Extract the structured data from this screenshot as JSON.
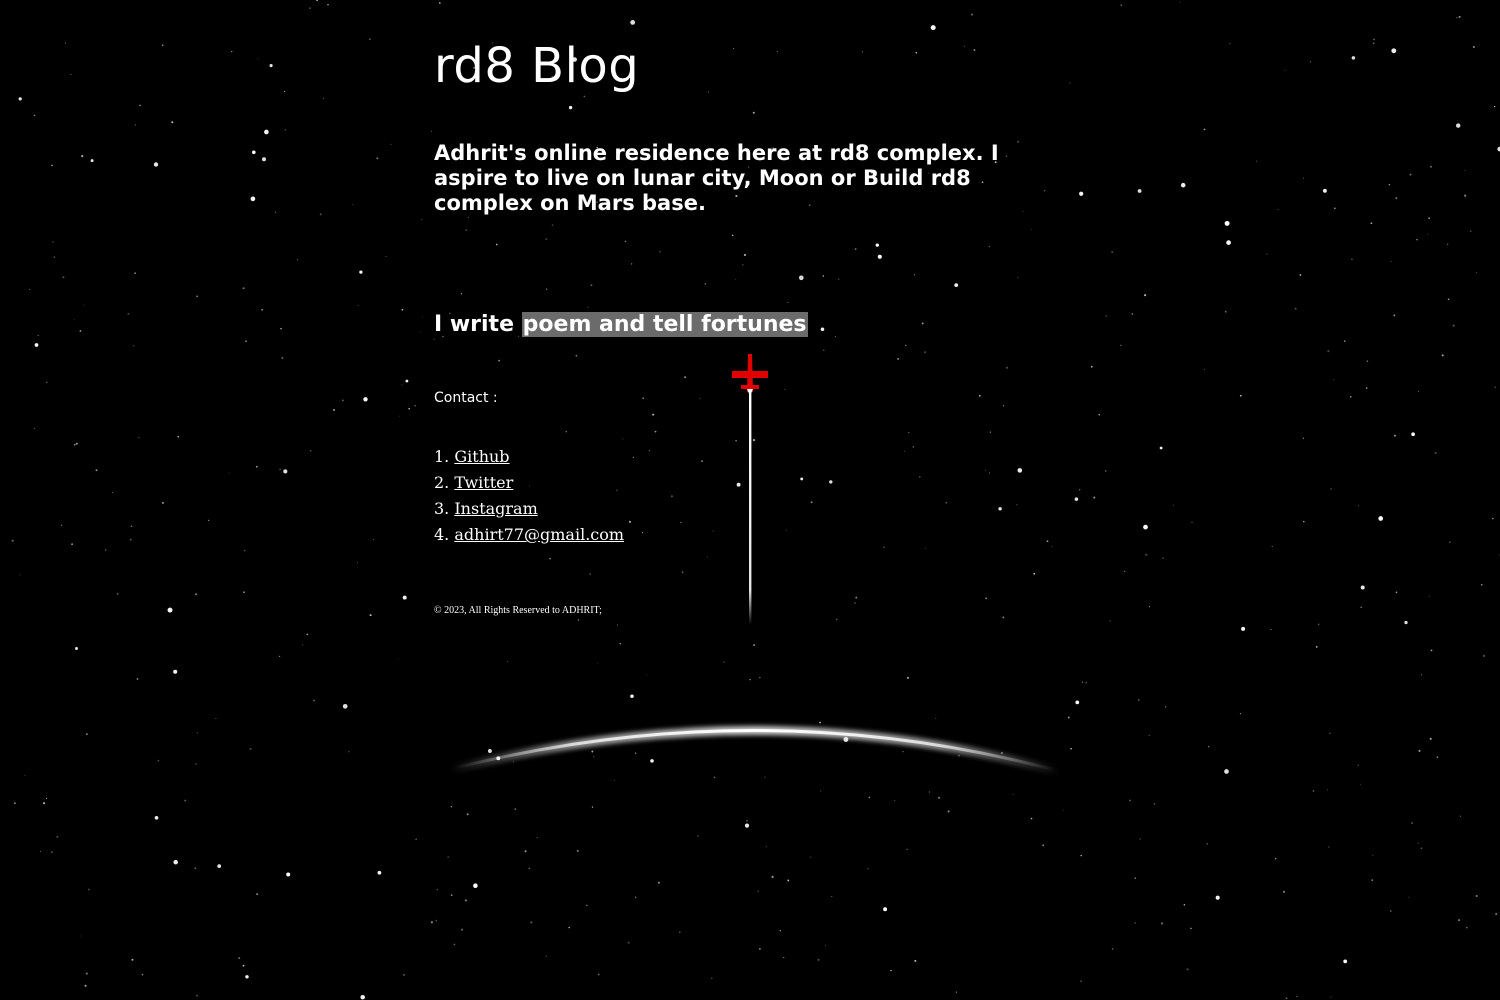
{
  "site": {
    "title": "rd8 Blog",
    "tagline": "Adhrit's online residence here at rd8 complex. I aspire to live on lunar city, Moon or Build rd8 complex on Mars base.",
    "writes_prefix": "I write ",
    "writes_highlight": "poem and tell fortunes"
  },
  "contact": {
    "label": "Contact :",
    "links": [
      {
        "number": "1.",
        "label": "Github"
      },
      {
        "number": "2.",
        "label": "Twitter"
      },
      {
        "number": "3.",
        "label": "Instagram"
      },
      {
        "number": "4.",
        "label": "adhirt77@gmail.com"
      }
    ]
  },
  "footer": {
    "text": "© 2023, All Rights Reserved to ADHRIT;"
  },
  "colors": {
    "background": "#000000",
    "text": "#ffffff",
    "highlight": "#6b6b6b",
    "rocket": "#e00000"
  },
  "icons": {
    "rocket": "rocket-icon"
  }
}
